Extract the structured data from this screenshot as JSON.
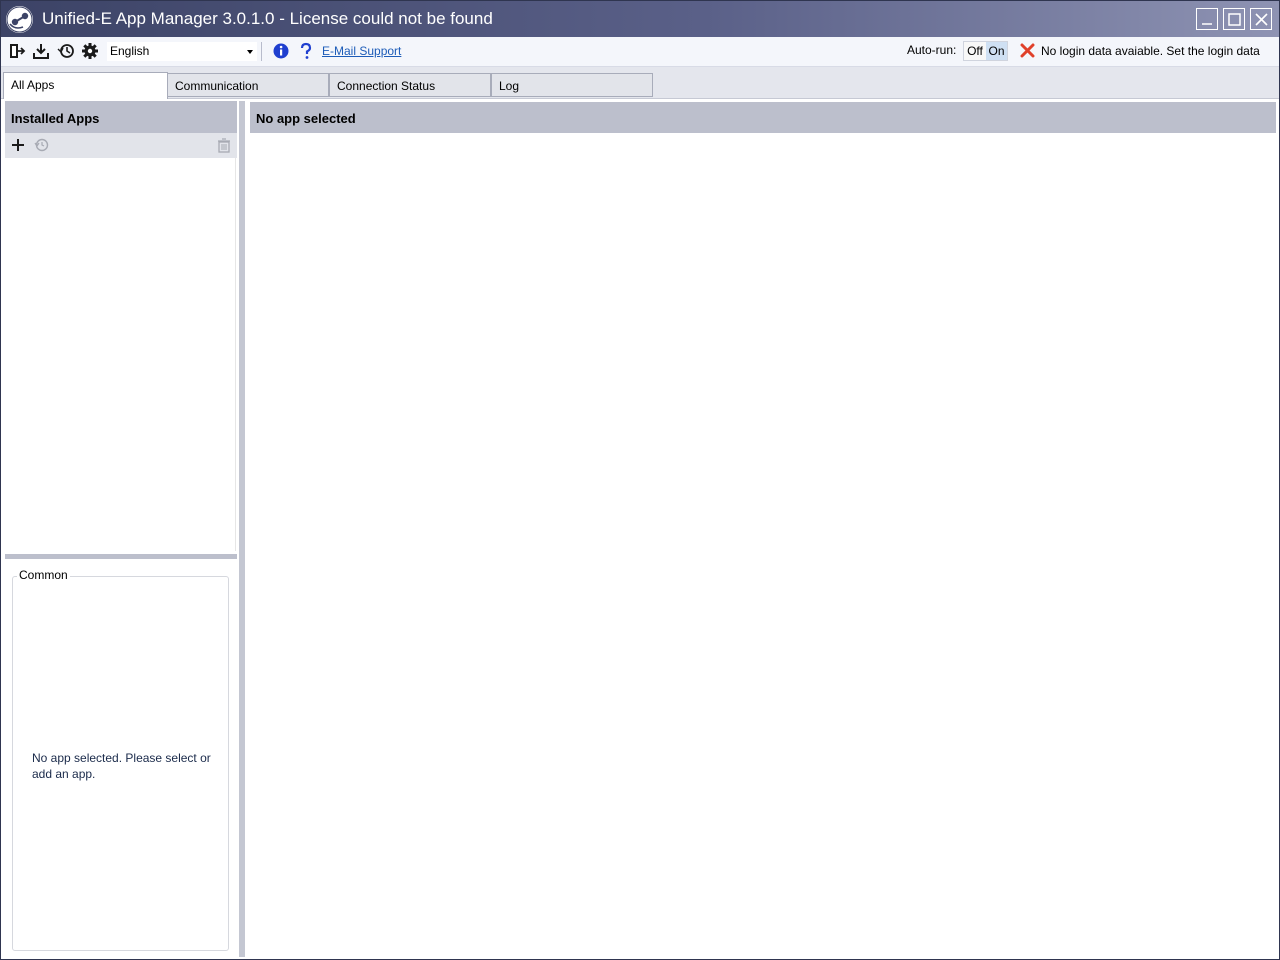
{
  "window": {
    "title": "Unified-E App Manager 3.0.1.0 - License could not be found",
    "logo_icon": "unified-e-logo-icon",
    "controls": [
      "minimize-icon",
      "maximize-icon",
      "close-icon"
    ]
  },
  "toolbar": {
    "icons": [
      "exit-icon",
      "download-icon",
      "history-icon",
      "gear-icon",
      "info-icon",
      "help-icon"
    ],
    "language_value": "English",
    "email_support_label": "E-Mail Support",
    "autorun_label": "Auto-run:",
    "autorun_off": "Off",
    "autorun_on": "On",
    "autorun_state": "On",
    "status_icon": "error-x-icon",
    "status_text": "No login data avaiable. Set the login data"
  },
  "tabs": [
    {
      "label": "All Apps",
      "active": true
    },
    {
      "label": "Communication",
      "active": false
    },
    {
      "label": "Connection Status",
      "active": false
    },
    {
      "label": "Log",
      "active": false
    }
  ],
  "left_panel": {
    "header": "Installed Apps",
    "toolbar_icons": [
      "add-icon",
      "refresh-icon",
      "delete-icon"
    ],
    "common_legend": "Common",
    "common_message": "No app selected. Please select or add an app."
  },
  "right_panel": {
    "header": "No app selected"
  },
  "colors": {
    "title_gradient_start": "#3c4366",
    "title_gradient_end": "#8e93b3",
    "panel_header": "#bcbfcc",
    "link": "#1d5cb8",
    "info_blue": "#1f3fcf",
    "error_red": "#e0402a"
  }
}
